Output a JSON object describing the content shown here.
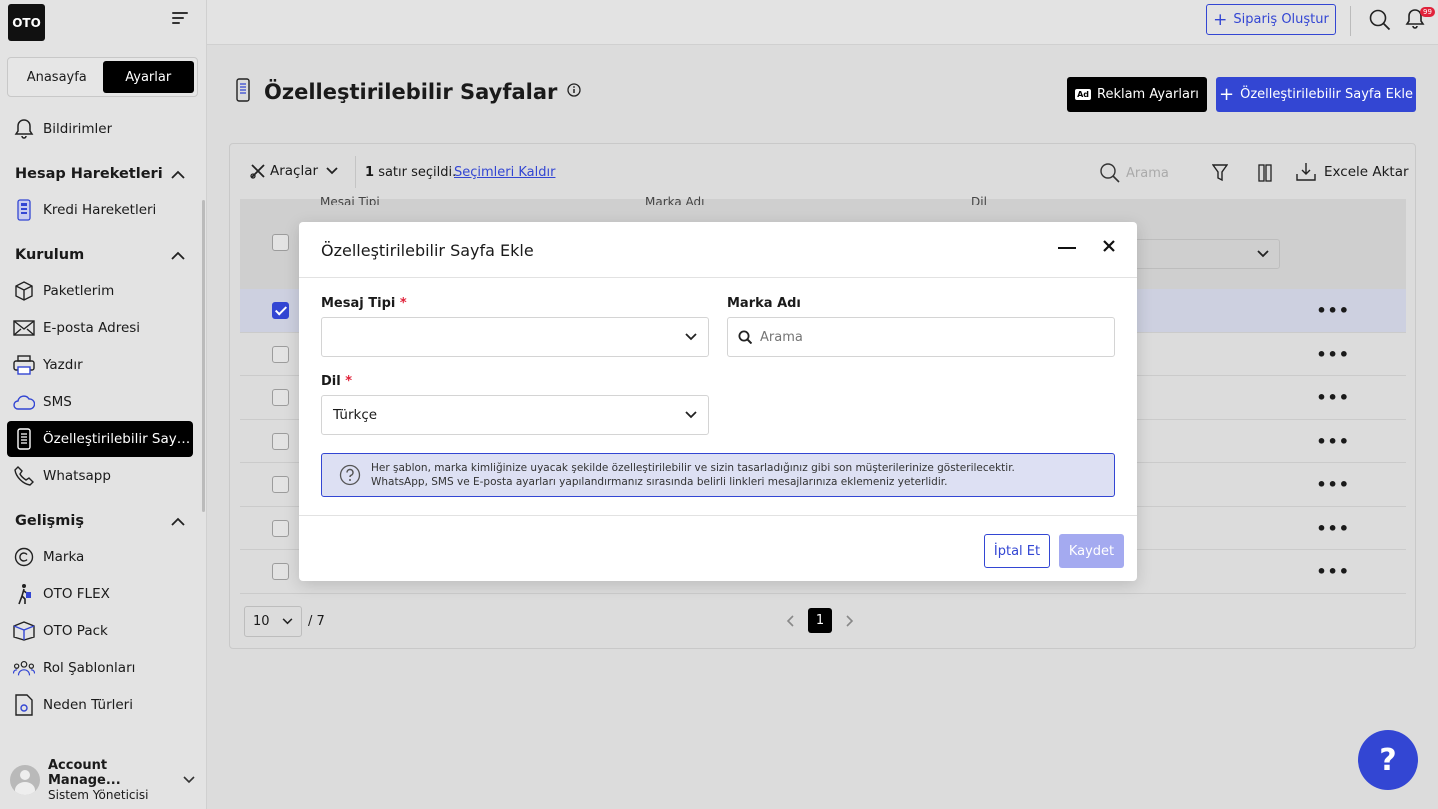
{
  "sidebar": {
    "logo": "OTO",
    "tabs": [
      "Anasayfa",
      "Ayarlar"
    ],
    "notifications": "Bildirimler",
    "sections": {
      "account": "Hesap Hareketleri",
      "setup": "Kurulum",
      "advanced": "Gelişmiş"
    },
    "items": {
      "credit": "Kredi Hareketleri",
      "packages": "Paketlerim",
      "email": "E-posta Adresi",
      "printer": "Yazdır",
      "sms": "SMS",
      "custom_pages": "Özelleştirilebilir Sayfalar",
      "whatsapp": "Whatsapp",
      "brand": "Marka",
      "flex": "OTO FLEX",
      "pack": "OTO Pack",
      "roles": "Rol Şablonları",
      "reasons": "Neden Türleri"
    },
    "account": {
      "name": "Account Manage...",
      "role": "Sistem Yöneticisi"
    }
  },
  "topbar": {
    "create_order": "Sipariş Oluştur",
    "badge": "99"
  },
  "page": {
    "title": "Özelleştirilebilir Sayfalar",
    "ad_settings": "Reklam Ayarları",
    "ad_badge": "Ad",
    "add_page": "Özelleştirilebilir Sayfa Ekle"
  },
  "toolbar": {
    "tools": "Araçlar",
    "selected_count": "1",
    "selected_text": "satır seçildi.",
    "clear_selection": "Seçimleri Kaldır",
    "search_placeholder": "Arama",
    "export": "Excele Aktar"
  },
  "table": {
    "headers": [
      "Mesaj Tipi",
      "Marka Adı",
      "Dil"
    ]
  },
  "pagination": {
    "page_size": "10",
    "total_pages": "/ 7",
    "current_page": "1"
  },
  "modal": {
    "title": "Özelleştirilebilir Sayfa Ekle",
    "message_type_label": "Mesaj Tipi",
    "brand_label": "Marka Adı",
    "brand_placeholder": "Arama",
    "language_label": "Dil",
    "language_value": "Türkçe",
    "required_mark": "*",
    "info_line1": "Her şablon, marka kimliğinize uyacak şekilde özelleştirilebilir ve sizin tasarladığınız gibi son müşterilerinize gösterilecektir.",
    "info_line2": "WhatsApp, SMS ve E-posta ayarları yapılandırmanız sırasında belirli linkleri mesajlarınıza eklemeniz yeterlidir.",
    "cancel": "İptal Et",
    "save": "Kaydet"
  },
  "help": "?",
  "colors": {
    "accent": "#3346d3",
    "dark": "#000000",
    "badge": "#e0223a"
  }
}
